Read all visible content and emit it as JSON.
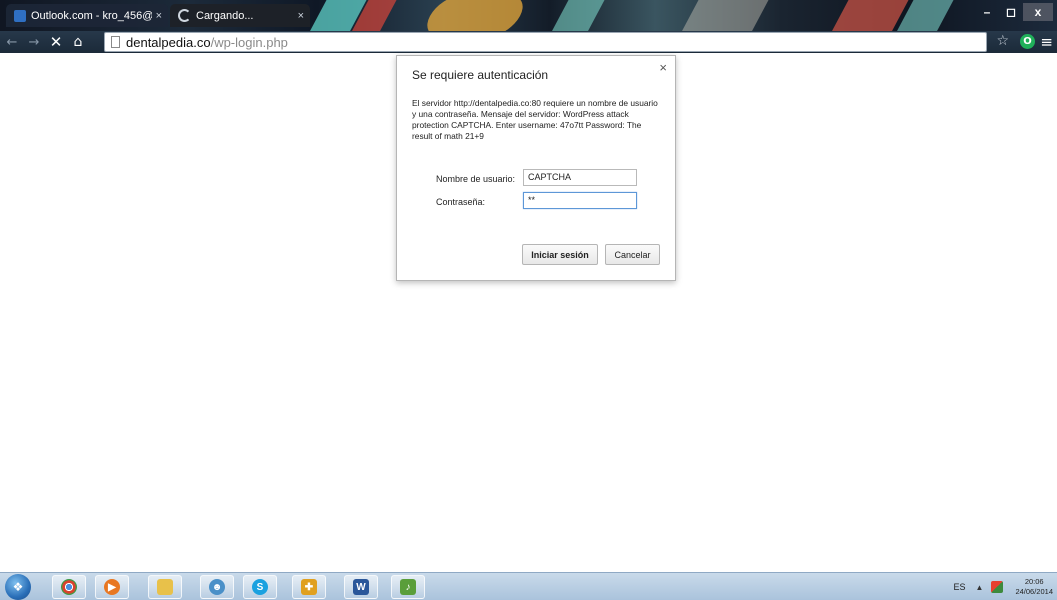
{
  "browser": {
    "tabs": [
      {
        "label": "Outlook.com - kro_456@",
        "active": false
      },
      {
        "label": "Cargando...",
        "active": true
      }
    ],
    "window_controls": {
      "minimize": "–",
      "maximize": "◻",
      "close": "x"
    },
    "nav": {
      "back": "←",
      "forward": "→",
      "stop": "✕",
      "home": "⌂"
    },
    "url": {
      "host": "dentalpedia.co",
      "path": "/wp-login.php"
    },
    "star": "☆",
    "extension": "O",
    "menu": "≡"
  },
  "dialog": {
    "title": "Se requiere autenticación",
    "close": "×",
    "message": "El servidor http://dentalpedia.co:80 requiere un nombre de usuario y una contraseña. Mensaje del servidor: WordPress attack protection CAPTCHA. Enter username: 47o7tt Password: The result of math 21+9",
    "username_label": "Nombre de usuario:",
    "username_value": "CAPTCHA",
    "password_label": "Contraseña:",
    "password_value": "**",
    "login_button": "Iniciar sesión",
    "cancel_button": "Cancelar"
  },
  "taskbar": {
    "apps": [
      {
        "icon": "chrome-icon",
        "color": "#d9422e"
      },
      {
        "icon": "media-player-icon",
        "color": "#e87722"
      },
      {
        "icon": "folder-icon",
        "color": "#e8c14a"
      },
      {
        "icon": "users-icon",
        "color": "#4a90c8"
      },
      {
        "icon": "skype-icon",
        "color": "#1aa1e0"
      },
      {
        "icon": "shield-icon",
        "color": "#e0a020"
      },
      {
        "icon": "word-icon",
        "color": "#2b579a"
      },
      {
        "icon": "sound-icon",
        "color": "#5a9e3a"
      }
    ],
    "language": "ES",
    "time": "20:06",
    "date": "24/06/2014"
  },
  "colors": {
    "taskbar": "#b8cde3",
    "titlebar": "#1c2a3a",
    "focus_border": "#5d97d7"
  }
}
